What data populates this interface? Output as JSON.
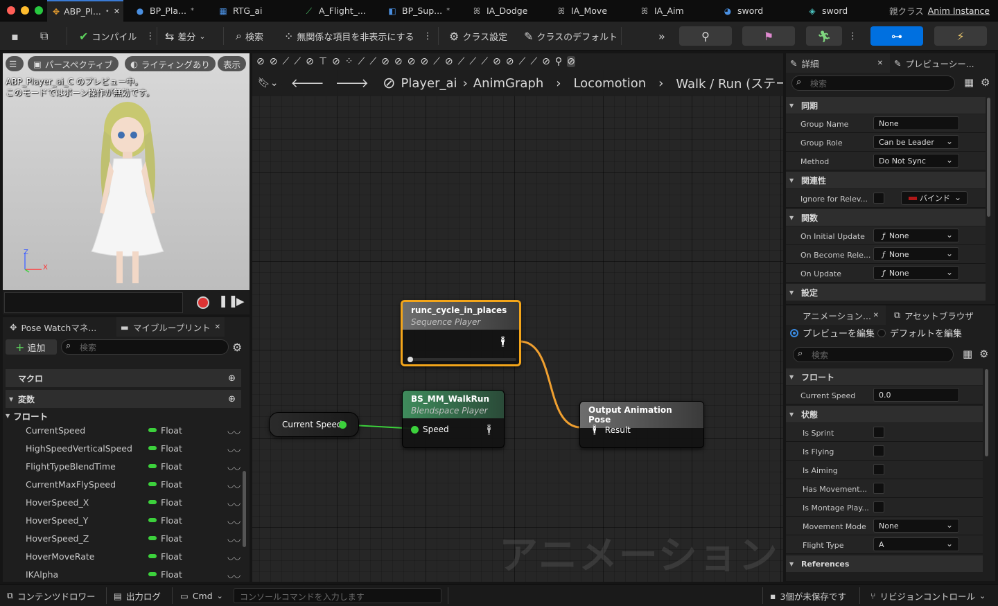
{
  "tabs": [
    {
      "label": "ABP_Pl...",
      "mod": "•",
      "active": true
    },
    {
      "label": "BP_Pla...",
      "mod": "*"
    },
    {
      "label": "RTG_ai",
      "mod": ""
    },
    {
      "label": "A_Flight_...",
      "mod": ""
    },
    {
      "label": "BP_Sup...",
      "mod": "*"
    },
    {
      "label": "IA_Dodge",
      "mod": ""
    },
    {
      "label": "IA_Move",
      "mod": ""
    },
    {
      "label": "IA_Aim",
      "mod": ""
    },
    {
      "label": "sword",
      "mod": ""
    },
    {
      "label": "sword",
      "mod": ""
    }
  ],
  "parent_class": {
    "label": "親クラス",
    "value": "Anim Instance"
  },
  "toolbar": {
    "compile": "コンパイル",
    "diff": "差分",
    "search": "検索",
    "hide_unrelated": "無関係な項目を非表示にする",
    "class_settings": "クラス設定",
    "class_defaults": "クラスのデフォルト"
  },
  "viewport": {
    "perspective": "パースペクティブ",
    "lighting": "ライティングあり",
    "show": "表示",
    "message_line1": "ABP_Player_ai_C のプレビュー中。",
    "message_line2": "このモードではボーン操作が無効です。",
    "axis_z": "Z",
    "axis_x": "X"
  },
  "left_panel": {
    "tab_pose_watch": "Pose Watchマネ...",
    "tab_my_blueprint": "マイブループリント",
    "add": "追加",
    "search_placeholder": "検索",
    "cat_macro": "マクロ",
    "cat_variables": "変数",
    "sub_flow": "フロート",
    "variables": [
      {
        "name": "CurrentSpeed",
        "type": "Float"
      },
      {
        "name": "HighSpeedVerticalSpeed",
        "type": "Float"
      },
      {
        "name": "FlightTypeBlendTime",
        "type": "Float"
      },
      {
        "name": "CurrentMaxFlySpeed",
        "type": "Float"
      },
      {
        "name": "HoverSpeed_X",
        "type": "Float"
      },
      {
        "name": "HoverSpeed_Y",
        "type": "Float"
      },
      {
        "name": "HoverSpeed_Z",
        "type": "Float"
      },
      {
        "name": "HoverMoveRate",
        "type": "Float"
      },
      {
        "name": "IKAlpha",
        "type": "Float"
      }
    ]
  },
  "graph": {
    "breadcrumb": [
      "Player_ai",
      "AnimGraph",
      "Locomotion",
      "Walk / Run (ステート)"
    ],
    "watermark": "アニメーション",
    "nodes": {
      "seq": {
        "title": "runc_cycle_in_places",
        "subtitle": "Sequence Player"
      },
      "blend": {
        "title": "BS_MM_WalkRun",
        "subtitle": "Blendspace Player",
        "pin": "Speed"
      },
      "output": {
        "title": "Output Animation Pose",
        "pin": "Result"
      },
      "var": {
        "title": "Current Speed"
      }
    }
  },
  "details": {
    "tab_details": "詳細",
    "tab_preview": "プレビューシー...",
    "search_placeholder": "検索",
    "cat_sync": "同期",
    "group_name_label": "Group Name",
    "group_name": "None",
    "group_role_label": "Group Role",
    "group_role": "Can be Leader",
    "method_label": "Method",
    "method": "Do Not Sync",
    "cat_relevancy": "関連性",
    "ignore_relevancy_label": "Ignore for Relev...",
    "bind": "バインド",
    "cat_functions": "関数",
    "on_initial_update_label": "On Initial Update",
    "on_initial_update": "None",
    "on_become_relevant_label": "On Become Rele...",
    "on_become_relevant": "None",
    "on_update_label": "On Update",
    "on_update": "None",
    "cat_settings": "設定"
  },
  "anim_panel": {
    "tab_anim": "アニメーション...",
    "tab_asset_browser": "アセットブラウザ",
    "radio_edit_preview": "プレビューを編集",
    "radio_edit_defaults": "デフォルトを編集",
    "search_placeholder": "検索",
    "cat_flow": "フロート",
    "current_speed_label": "Current Speed",
    "current_speed": "0.0",
    "cat_state": "状態",
    "is_sprint": "Is Sprint",
    "is_flying": "Is Flying",
    "is_aiming": "Is Aiming",
    "has_movement": "Has Movement...",
    "is_montage": "Is Montage Play...",
    "movement_mode_label": "Movement Mode",
    "movement_mode": "None",
    "flight_type_label": "Flight Type",
    "flight_type": "A",
    "cat_references": "References"
  },
  "statusbar": {
    "content_drawer": "コンテンツドロワー",
    "output_log": "出力ログ",
    "cmd": "Cmd",
    "console_placeholder": "コンソールコマンドを入力します",
    "unsaved": "3個が未保存です",
    "revision_control": "リビジョンコントロール"
  },
  "colors": {
    "accent": "#0070e0",
    "exec_wire": "#f0a030",
    "float_pin": "#3cd13c",
    "selected_outline": "#f3a51a"
  }
}
